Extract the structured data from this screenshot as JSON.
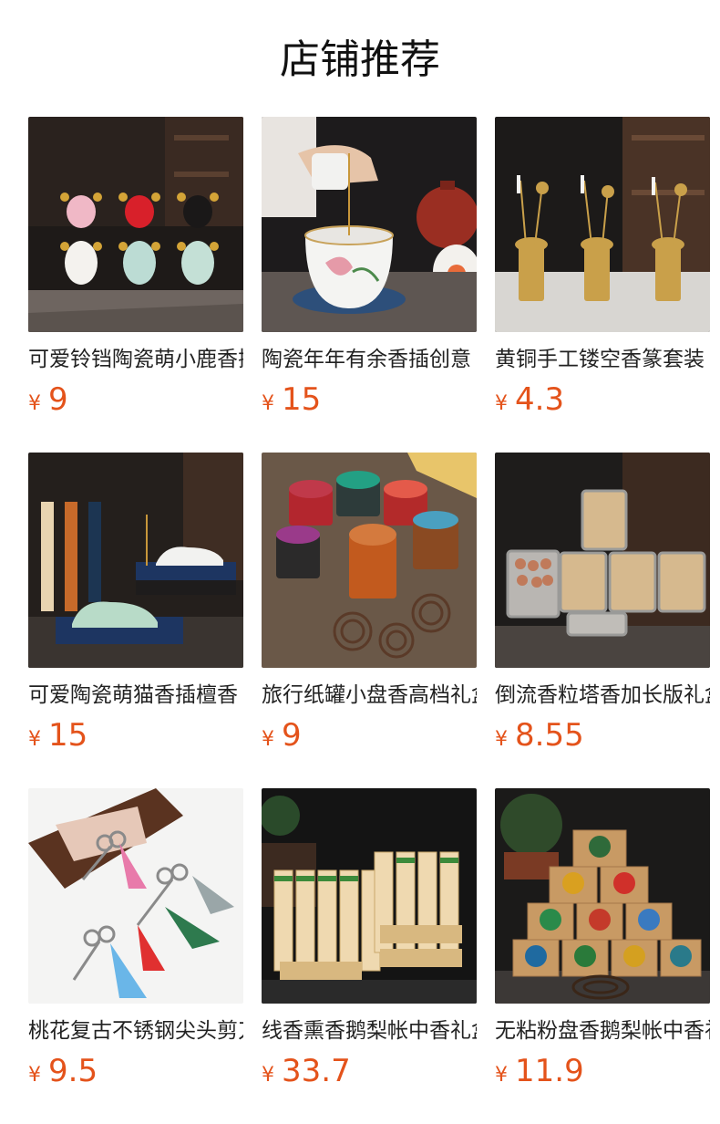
{
  "header": {
    "title": "店铺推荐"
  },
  "currency_symbol": "¥",
  "accent_color": "#e4531b",
  "products": [
    {
      "name": "可爱铃铛陶瓷萌小鹿香插",
      "price": "9",
      "icon": "ceramic-deer-figurines-image"
    },
    {
      "name": "陶瓷年年有余香插创意",
      "price": "15",
      "icon": "ceramic-incense-holder-image"
    },
    {
      "name": "黄铜手工镂空香篆套装",
      "price": "4.3",
      "icon": "brass-incense-tools-image"
    },
    {
      "name": "可爱陶瓷萌猫香插檀香",
      "price": "15",
      "icon": "ceramic-cat-incense-holder-image"
    },
    {
      "name": "旅行纸罐小盘香高档礼盒",
      "price": "9",
      "icon": "paper-can-coil-incense-image"
    },
    {
      "name": "倒流香粒塔香加长版礼盒",
      "price": "8.55",
      "icon": "backflow-cone-incense-tins-image"
    },
    {
      "name": "桃花复古不锈钢尖头剪刀",
      "price": "9.5",
      "icon": "vintage-scissors-image"
    },
    {
      "name": "线香熏香鹅梨帐中香礼盒",
      "price": "33.7",
      "icon": "stick-incense-boxes-image"
    },
    {
      "name": "无粘粉盘香鹅梨帐中香礼盒",
      "price": "11.9",
      "icon": "coil-incense-boxes-image"
    }
  ]
}
